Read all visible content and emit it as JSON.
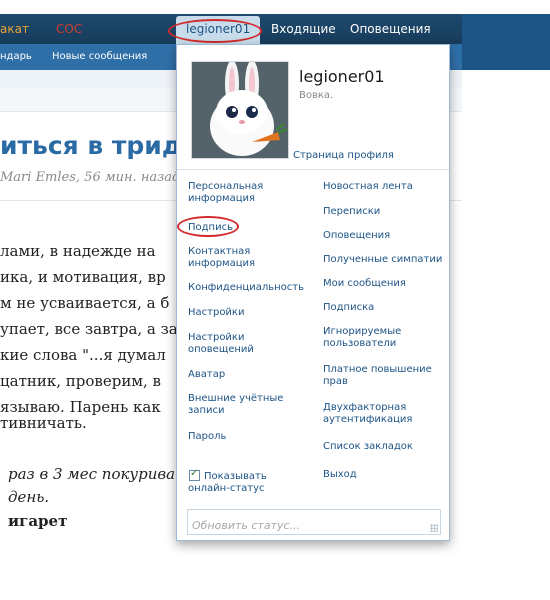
{
  "top_nav": {
    "left_item_1": "акат",
    "left_item_2": "СОС"
  },
  "sub_nav": {
    "item_1": "ндарь",
    "item_2": "Новые сообщения"
  },
  "visitor_tabs": {
    "username": "legioner01",
    "inbox": "Входящие",
    "alerts": "Оповещения"
  },
  "thread": {
    "title": "иться в трид",
    "meta": "Mari Emles, 56 мин. назад",
    "lines": [
      "лами, в надежде на",
      "ика, и мотивация, вр",
      "м не усваивается, а б",
      "упает, все завтра, а за",
      "кие слова \"...я думал",
      "цатник, проверим, в",
      "язываю. Парень как",
      "тивничать.",
      "раз в 3 мес покурива",
      "день.",
      "игарет"
    ]
  },
  "popup": {
    "username": "legioner01",
    "user_status": "Вовка.",
    "profile_link": "Страница профиля",
    "left_menu": [
      "Персональная информация",
      "Подпись",
      "Контактная информация",
      "Конфиденциальность",
      "Настройки",
      "Настройки оповещений",
      "Аватар",
      "Внешние учётные записи",
      "Пароль"
    ],
    "right_menu": [
      "Новостная лента",
      "Переписки",
      "Оповещения",
      "Полученные симпатии",
      "Мои сообщения",
      "Подписка",
      "Игнорируемые пользователи",
      "Платное повышение прав",
      "Двухфакторная аутентификация",
      "Список закладок",
      "Выход"
    ],
    "show_online_label": "Показывать онлайн-статус",
    "show_online_checked": true,
    "status_placeholder": "Обновить статус..."
  },
  "colors": {
    "accent_blue": "#1d5486",
    "annotation_red": "#d22a2a",
    "header_dark": "#1e4a6e"
  }
}
